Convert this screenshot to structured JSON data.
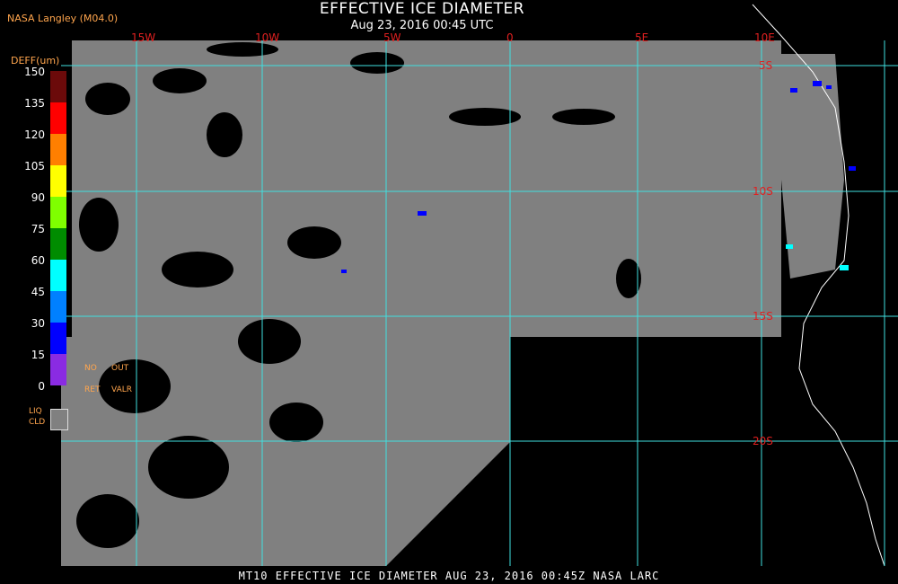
{
  "header": {
    "title": "EFFECTIVE ICE DIAMETER",
    "subtitle": "Aug 23, 2016 00:45 UTC",
    "producer": "NASA Langley (M04.0)"
  },
  "colorbar": {
    "units": "DEFF(um)",
    "ticks": [
      "150",
      "135",
      "120",
      "105",
      "90",
      "75",
      "60",
      "45",
      "30",
      "15",
      "0"
    ],
    "colors": [
      "#6b0a0a",
      "#ff0000",
      "#ff7f00",
      "#ffff00",
      "#7fff00",
      "#008c00",
      "#00ffff",
      "#0080ff",
      "#0000ff",
      "#8a2be2"
    ],
    "no_ret": [
      "NO",
      "RET"
    ],
    "out_valr": [
      "OUT",
      "VALR"
    ],
    "liq_label": [
      "LIQ",
      "CLD"
    ],
    "liq_color": "#808080"
  },
  "map": {
    "lon_labels": [
      "15W",
      "10W",
      "5W",
      "0",
      "5E",
      "10E"
    ],
    "lat_labels": [
      "5S",
      "10S",
      "15S",
      "20S"
    ],
    "grid_color": "#40e0e0",
    "cloud_color": "#808080",
    "clear_color": "#000000"
  },
  "footer": {
    "text": "MT10  EFFECTIVE ICE DIAMETER   AUG 23, 2016 00:45Z   NASA LARC"
  }
}
